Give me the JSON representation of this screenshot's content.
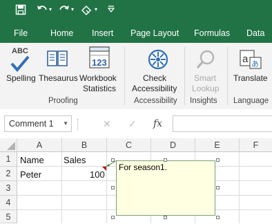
{
  "quick_access": {
    "save_icon": "save-icon",
    "undo_icon": "undo-icon",
    "redo_icon": "redo-icon",
    "touch_mode_icon": "touch-mode-icon",
    "customize_icon": "customize-qat-icon"
  },
  "tabs": [
    "File",
    "Home",
    "Insert",
    "Page Layout",
    "Formulas",
    "Data"
  ],
  "ribbon": {
    "spelling": {
      "icon_text": "ABC",
      "label": "Spelling"
    },
    "thesaurus": {
      "label": "Thesaurus"
    },
    "workbook_statistics": {
      "icon_text": "123",
      "line1": "Workbook",
      "line2": "Statistics"
    },
    "check_accessibility": {
      "line1": "Check",
      "line2": "Accessibility"
    },
    "smart_lookup": {
      "line1": "Smart",
      "line2": "Lookup"
    },
    "translate": {
      "label": "Translate"
    },
    "groups": [
      "Proofing",
      "Accessibility",
      "Insights",
      "Language"
    ]
  },
  "formula_bar": {
    "name_box": "Comment 1",
    "cancel_symbol": "✕",
    "enter_symbol": "✓",
    "fx_symbol": "fx",
    "formula": ""
  },
  "sheet": {
    "columns": [
      "A",
      "B",
      "C",
      "D",
      "E",
      "F"
    ],
    "rows": [
      "1",
      "2",
      "3",
      "4",
      "5"
    ],
    "cells": {
      "A1": "Name",
      "B1": "Sales",
      "A2": "Peter",
      "B2": "100"
    }
  },
  "comment": {
    "text": "For season1."
  },
  "colors": {
    "brand": "#217346",
    "comment_bg": "#ffffe1",
    "indicator": "#c00000"
  }
}
